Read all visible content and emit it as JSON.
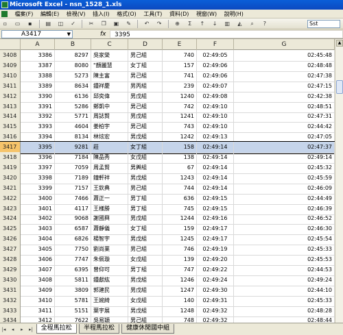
{
  "window": {
    "title": "Microsoft Excel - nsn_1528_1.xls"
  },
  "menu": [
    "檔案(F)",
    "編輯(E)",
    "檢視(V)",
    "插入(I)",
    "格式(O)",
    "工具(T)",
    "資料(D)",
    "視窗(W)",
    "說明(H)"
  ],
  "toolbar": {
    "font_name": "Sst"
  },
  "formula_bar": {
    "cell_ref": "A3417",
    "fx": "fx",
    "value": "3395"
  },
  "columns": [
    "A",
    "B",
    "C",
    "D",
    "E",
    "F",
    "G"
  ],
  "selected_row": "3417",
  "rows": [
    {
      "r": "3408",
      "a": "3386",
      "b": "8297",
      "c": "吳家榮",
      "d": "男己組",
      "e": "740",
      "f": "02:49:05",
      "g": "02:45:48"
    },
    {
      "r": "3409",
      "a": "3387",
      "b": "8080",
      "c": "\"顏麗慧",
      "d": "女丁組",
      "e": "157",
      "f": "02:49:06",
      "g": "02:48:48"
    },
    {
      "r": "3410",
      "a": "3388",
      "b": "5273",
      "c": "陳主富",
      "d": "男己組",
      "e": "741",
      "f": "02:49:06",
      "g": "02:47:38"
    },
    {
      "r": "3411",
      "a": "3389",
      "b": "8634",
      "c": "鍾祥慶",
      "d": "男丙組",
      "e": "239",
      "f": "02:49:07",
      "g": "02:47:15"
    },
    {
      "r": "3412",
      "a": "3390",
      "b": "6136",
      "c": "邱奕偉",
      "d": "男戊組",
      "e": "1240",
      "f": "02:49:08",
      "g": "02:42:38"
    },
    {
      "r": "3413",
      "a": "3391",
      "b": "5286",
      "c": "鄭凱中",
      "d": "男己組",
      "e": "742",
      "f": "02:49:10",
      "g": "02:48:51"
    },
    {
      "r": "3414",
      "a": "3392",
      "b": "5771",
      "c": "周誌賢",
      "d": "男戊組",
      "e": "1241",
      "f": "02:49:10",
      "g": "02:47:31"
    },
    {
      "r": "3415",
      "a": "3393",
      "b": "4604",
      "c": "姜柏宇",
      "d": "男己組",
      "e": "743",
      "f": "02:49:10",
      "g": "02:44:42"
    },
    {
      "r": "3416",
      "a": "3394",
      "b": "8134",
      "c": "林炫宏",
      "d": "男戊組",
      "e": "1242",
      "f": "02:49:13",
      "g": "02:47:05"
    },
    {
      "r": "3417",
      "a": "3395",
      "b": "9281",
      "c": "莊",
      "d": "女丁組",
      "e": "158",
      "f": "02:49:14",
      "g": "02:47:37"
    },
    {
      "r": "3418",
      "a": "3396",
      "b": "7184",
      "c": "陳品秀",
      "d": "女戊組",
      "e": "138",
      "f": "02:49:14",
      "g": "02:49:14"
    },
    {
      "r": "3419",
      "a": "3397",
      "b": "7059",
      "c": "周孟賢",
      "d": "男輿組",
      "e": "67",
      "f": "02:49:14",
      "g": "02:45:32"
    },
    {
      "r": "3420",
      "a": "3398",
      "b": "7189",
      "c": "鐘軒祥",
      "d": "男戊組",
      "e": "1243",
      "f": "02:49:14",
      "g": "02:45:59"
    },
    {
      "r": "3421",
      "a": "3399",
      "b": "7157",
      "c": "王欽典",
      "d": "男己組",
      "e": "744",
      "f": "02:49:14",
      "g": "02:46:09"
    },
    {
      "r": "3422",
      "a": "3400",
      "b": "7466",
      "c": "蕭正一",
      "d": "男丁組",
      "e": "636",
      "f": "02:49:15",
      "g": "02:44:49"
    },
    {
      "r": "3423",
      "a": "3401",
      "b": "4117",
      "c": "王樣勝",
      "d": "男丁組",
      "e": "745",
      "f": "02:49:15",
      "g": "02:46:39"
    },
    {
      "r": "3424",
      "a": "3402",
      "b": "9068",
      "c": "謝國興",
      "d": "男戊組",
      "e": "1244",
      "f": "02:49:16",
      "g": "02:46:52"
    },
    {
      "r": "3425",
      "a": "3403",
      "b": "6587",
      "c": "蕭靜儀",
      "d": "女丁組",
      "e": "159",
      "f": "02:49:17",
      "g": "02:46:30"
    },
    {
      "r": "3426",
      "a": "3404",
      "b": "6826",
      "c": "楊智宇",
      "d": "男戊組",
      "e": "1245",
      "f": "02:49:17",
      "g": "02:45:54"
    },
    {
      "r": "3427",
      "a": "3405",
      "b": "7750",
      "c": "劉尚業",
      "d": "男己組",
      "e": "746",
      "f": "02:49:19",
      "g": "02:45:33"
    },
    {
      "r": "3428",
      "a": "3406",
      "b": "7747",
      "c": "朱佩璇",
      "d": "女戊組",
      "e": "139",
      "f": "02:49:20",
      "g": "02:45:53"
    },
    {
      "r": "3429",
      "a": "3407",
      "b": "6395",
      "c": "曾仰可",
      "d": "男丁組",
      "e": "747",
      "f": "02:49:22",
      "g": "02:44:53"
    },
    {
      "r": "3430",
      "a": "3408",
      "b": "5811",
      "c": "鍾獻紘",
      "d": "男戊組",
      "e": "1246",
      "f": "02:49:24",
      "g": "02:49:24"
    },
    {
      "r": "3431",
      "a": "3409",
      "b": "3809",
      "c": "郭建民",
      "d": "男戊組",
      "e": "1247",
      "f": "02:49:30",
      "g": "02:44:10"
    },
    {
      "r": "3432",
      "a": "3410",
      "b": "5781",
      "c": "王婉綺",
      "d": "女戊組",
      "e": "140",
      "f": "02:49:31",
      "g": "02:45:33"
    },
    {
      "r": "3433",
      "a": "3411",
      "b": "5151",
      "c": "葉宇展",
      "d": "男戊組",
      "e": "1248",
      "f": "02:49:32",
      "g": "02:48:28"
    },
    {
      "r": "3434",
      "a": "3412",
      "b": "7622",
      "c": "吳易穎",
      "d": "男己組",
      "e": "748",
      "f": "02:49:32",
      "g": "02:48:44"
    }
  ],
  "sheet_tabs": [
    "全程馬拉松",
    "半程馬拉松",
    "健康休閒國中組"
  ],
  "nav_arrows": [
    "|◂",
    "◂",
    "▸",
    "▸|"
  ]
}
